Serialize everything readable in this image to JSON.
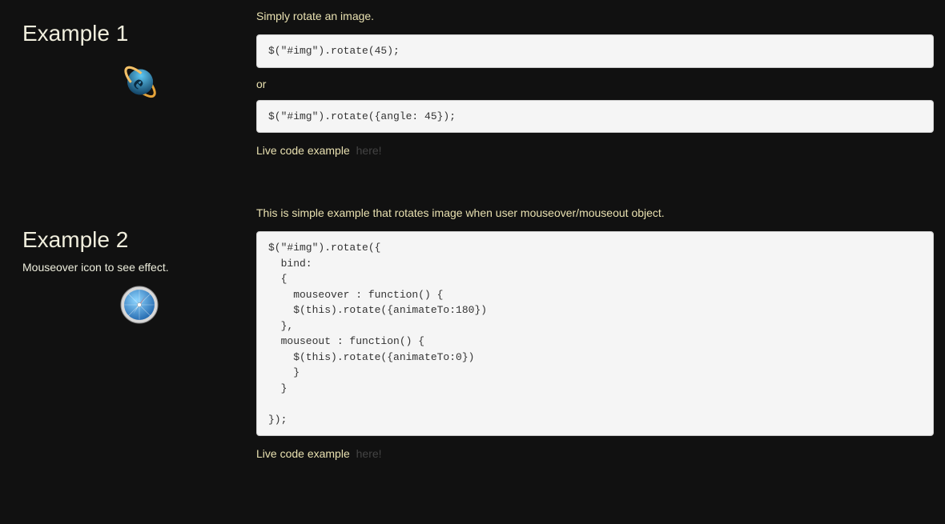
{
  "examples": [
    {
      "title": "Example 1",
      "subtitle": "",
      "description": "Simply rotate an image.",
      "code_blocks": [
        "$(\"#img\").rotate(45);",
        "$(\"#img\").rotate({angle: 45});"
      ],
      "separator": "or",
      "live_label": "Live code example",
      "live_link_text": "here!"
    },
    {
      "title": "Example 2",
      "subtitle": "Mouseover icon to see effect.",
      "description": "This is simple example that rotates image when user mouseover/mouseout object.",
      "code_blocks": [
        "$(\"#img\").rotate({\n  bind:\n  {\n    mouseover : function() {\n    $(this).rotate({animateTo:180})\n  },\n  mouseout : function() {\n    $(this).rotate({animateTo:0})\n    }\n  }\n\n});"
      ],
      "separator": "",
      "live_label": "Live code example",
      "live_link_text": "here!"
    }
  ]
}
